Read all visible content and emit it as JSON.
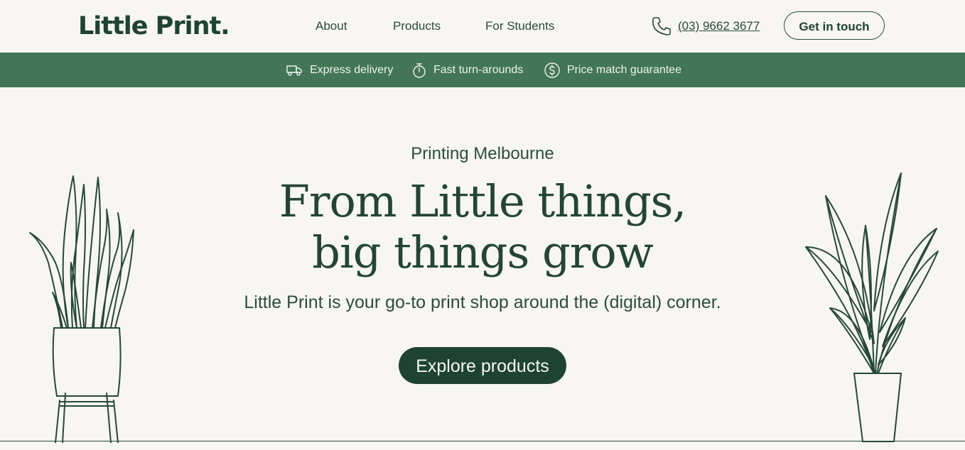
{
  "header": {
    "logo": "Little Print.",
    "nav": [
      {
        "label": "About"
      },
      {
        "label": "Products"
      },
      {
        "label": "For Students"
      }
    ],
    "phone": "(03) 9662 3677",
    "contact_label": "Get in touch"
  },
  "promo": {
    "items": [
      {
        "icon": "truck-icon",
        "label": "Express delivery"
      },
      {
        "icon": "stopwatch-icon",
        "label": "Fast turn-arounds"
      },
      {
        "icon": "dollar-icon",
        "label": "Price match guarantee"
      }
    ]
  },
  "hero": {
    "eyebrow": "Printing Melbourne",
    "title_line1": "From Little things,",
    "title_line2": "big things grow",
    "subtitle": "Little Print is your go-to print shop around the (digital) corner.",
    "cta_label": "Explore products"
  },
  "colors": {
    "brand_green": "#1e4333",
    "promo_green": "#437657",
    "background": "#f7f6f2"
  }
}
